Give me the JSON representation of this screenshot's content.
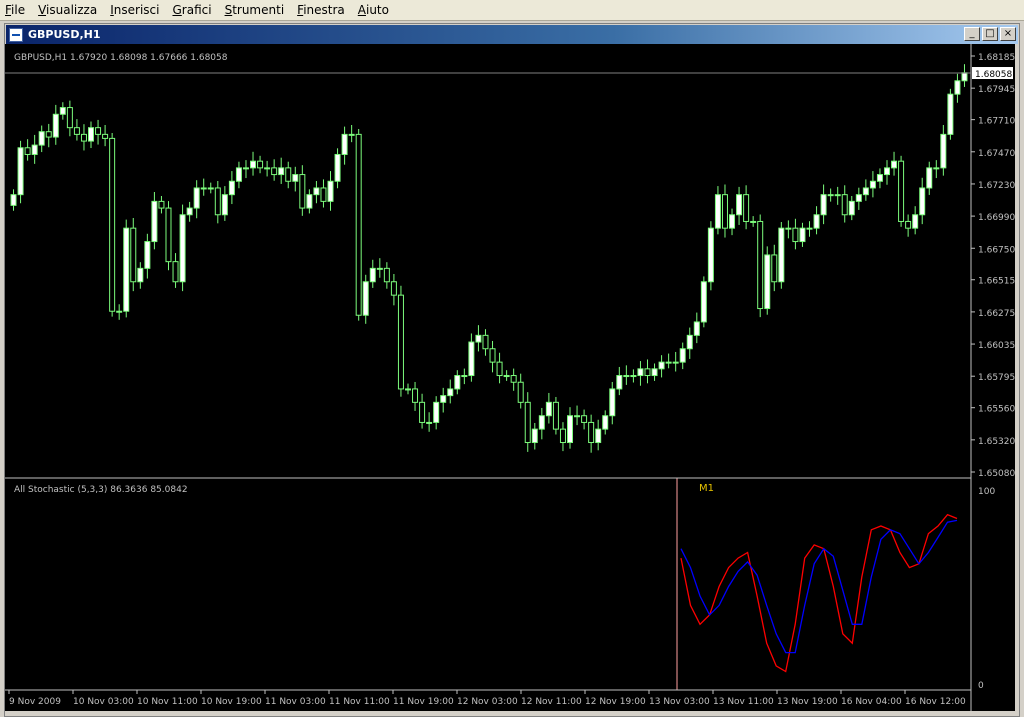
{
  "menu": [
    {
      "label": "File",
      "name": "menu-file"
    },
    {
      "label": "Visualizza",
      "name": "menu-visualizza"
    },
    {
      "label": "Inserisci",
      "name": "menu-inserisci"
    },
    {
      "label": "Grafici",
      "name": "menu-grafici"
    },
    {
      "label": "Strumenti",
      "name": "menu-strumenti"
    },
    {
      "label": "Finestra",
      "name": "menu-finestra"
    },
    {
      "label": "Aiuto",
      "name": "menu-aiuto"
    }
  ],
  "window": {
    "title": "GBPUSD,H1",
    "minimize": "_",
    "restore": "□",
    "close": "×"
  },
  "colors": {
    "background": "#000000",
    "bull": "#ffffff",
    "wick": "#7cfc7c",
    "grid_line": "#808080",
    "stoch_main": "#ff0000",
    "stoch_signal": "#0000ff",
    "separator": "#ff9fa0",
    "m1_label": "#e6c200"
  },
  "price_panel": {
    "header": "GBPUSD,H1  1.67920 1.68098 1.67666 1.68058",
    "current_price": "1.68058",
    "y_ticks": [
      "1.68185",
      "1.67945",
      "1.67710",
      "1.67470",
      "1.67230",
      "1.66990",
      "1.66750",
      "1.66515",
      "1.66275",
      "1.66035",
      "1.65795",
      "1.65560",
      "1.65320",
      "1.65080"
    ]
  },
  "indicator_panel": {
    "header": "All Stochastic (5,3,3) 86.3636 85.0842",
    "tf_label": "M1",
    "y_top": "100",
    "y_bottom": "0"
  },
  "x_labels": [
    "9 Nov 2009",
    "10 Nov 03:00",
    "10 Nov 11:00",
    "10 Nov 19:00",
    "11 Nov 03:00",
    "11 Nov 11:00",
    "11 Nov 19:00",
    "12 Nov 03:00",
    "12 Nov 11:00",
    "12 Nov 19:00",
    "13 Nov 03:00",
    "13 Nov 11:00",
    "13 Nov 19:00",
    "16 Nov 04:00",
    "16 Nov 12:00"
  ],
  "chart_data": [
    {
      "type": "candlestick",
      "title": "GBPUSD,H1",
      "ylim": [
        1.6508,
        1.6822
      ],
      "series": [
        {
          "name": "GBPUSD",
          "values": [
            1.6715,
            1.675,
            1.6745,
            1.6752,
            1.6762,
            1.6758,
            1.6775,
            1.678,
            1.6765,
            1.676,
            1.6755,
            1.6765,
            1.676,
            1.6757,
            1.6628,
            1.6628,
            1.669,
            1.665,
            1.666,
            1.668,
            1.671,
            1.6705,
            1.6665,
            1.665,
            1.67,
            1.6705,
            1.672,
            1.672,
            1.672,
            1.67,
            1.6715,
            1.6725,
            1.6735,
            1.6735,
            1.674,
            1.6735,
            1.6735,
            1.673,
            1.6735,
            1.6725,
            1.673,
            1.6705,
            1.6715,
            1.672,
            1.671,
            1.6725,
            1.6745,
            1.676,
            1.676,
            1.6625,
            1.665,
            1.666,
            1.666,
            1.665,
            1.664,
            1.657,
            1.657,
            1.656,
            1.6545,
            1.6545,
            1.656,
            1.6565,
            1.657,
            1.658,
            1.658,
            1.6605,
            1.661,
            1.66,
            1.659,
            1.658,
            1.658,
            1.6575,
            1.656,
            1.653,
            1.654,
            1.655,
            1.656,
            1.654,
            1.653,
            1.655,
            1.655,
            1.6545,
            1.653,
            1.654,
            1.655,
            1.657,
            1.658,
            1.658,
            1.658,
            1.6585,
            1.658,
            1.6585,
            1.659,
            1.659,
            1.659,
            1.66,
            1.661,
            1.662,
            1.665,
            1.669,
            1.6715,
            1.669,
            1.67,
            1.6715,
            1.6695,
            1.6695,
            1.663,
            1.667,
            1.665,
            1.669,
            1.669,
            1.668,
            1.669,
            1.669,
            1.67,
            1.6715,
            1.6715,
            1.6715,
            1.67,
            1.671,
            1.6715,
            1.672,
            1.6725,
            1.673,
            1.6735,
            1.674,
            1.6695,
            1.669,
            1.67,
            1.672,
            1.6735,
            1.6735,
            1.676,
            1.679,
            1.68,
            1.6806
          ]
        }
      ]
    },
    {
      "type": "line",
      "title": "All Stochastic (5,3,3)",
      "ylim": [
        0,
        100
      ],
      "series": [
        {
          "name": "main",
          "values": [
            65,
            40,
            30,
            35,
            50,
            60,
            65,
            68,
            45,
            20,
            8,
            5,
            30,
            65,
            72,
            70,
            50,
            25,
            20,
            55,
            80,
            82,
            80,
            68,
            60,
            62,
            78,
            82,
            88,
            86
          ]
        },
        {
          "name": "signal",
          "values": [
            70,
            60,
            45,
            35,
            40,
            50,
            58,
            63,
            56,
            40,
            25,
            15,
            15,
            40,
            62,
            70,
            66,
            48,
            30,
            30,
            55,
            75,
            80,
            78,
            70,
            62,
            68,
            76,
            84,
            85
          ]
        }
      ]
    }
  ]
}
